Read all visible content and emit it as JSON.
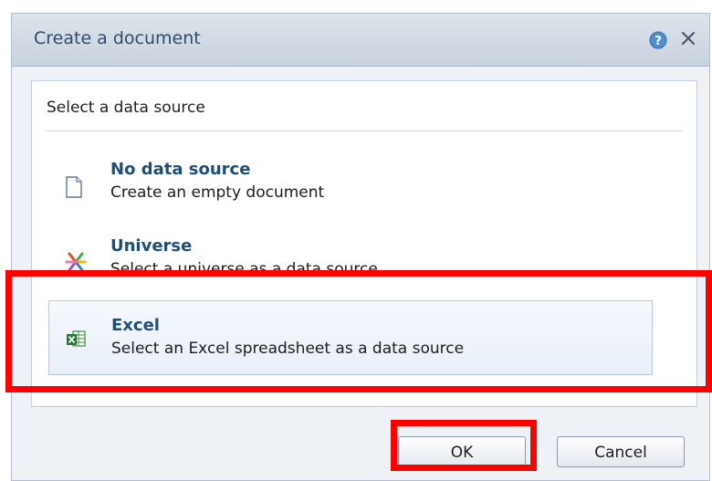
{
  "dialog": {
    "title": "Create a document",
    "help_icon": "help-icon",
    "close_icon": "close-icon"
  },
  "panel": {
    "label": "Select a data source",
    "options": [
      {
        "title": "No data source",
        "description": "Create an empty document",
        "icon": "blank-document-icon"
      },
      {
        "title": "Universe",
        "description": "Select a universe as a data source",
        "icon": "universe-icon"
      },
      {
        "title": "Excel",
        "description": "Select an Excel spreadsheet as a data source",
        "icon": "excel-icon",
        "selected": true
      }
    ]
  },
  "buttons": {
    "ok": "OK",
    "cancel": "Cancel"
  },
  "annotations": {
    "highlight_color": "#ff0000"
  }
}
